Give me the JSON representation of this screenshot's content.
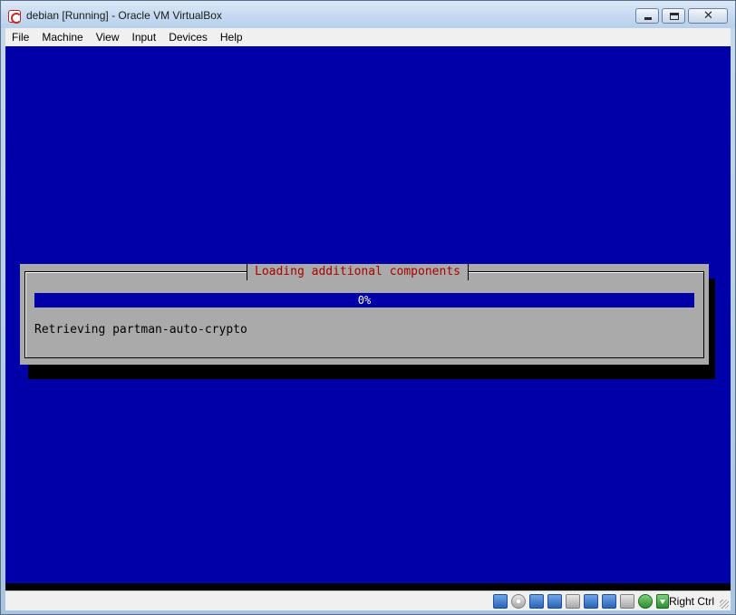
{
  "window": {
    "title": "debian [Running] - Oracle VM VirtualBox"
  },
  "menubar": {
    "items": [
      "File",
      "Machine",
      "View",
      "Input",
      "Devices",
      "Help"
    ]
  },
  "installer": {
    "dialog_title": "Loading additional components",
    "progress_text": "0%",
    "progress_value": 0,
    "status_text": "Retrieving partman-auto-crypto"
  },
  "statusbar": {
    "host_key_label": "Right Ctrl",
    "icons": [
      "hard-disk-icon",
      "optical-drive-icon",
      "usb-icon",
      "network-icon",
      "shared-folders-icon",
      "display-icon",
      "video-capture-icon",
      "cpu-icon",
      "mouse-integration-icon",
      "host-key-icon"
    ]
  },
  "colors": {
    "screen_bg": "#0000a8",
    "dialog_bg": "#aaaaaa",
    "dialog_title": "#a80000"
  }
}
